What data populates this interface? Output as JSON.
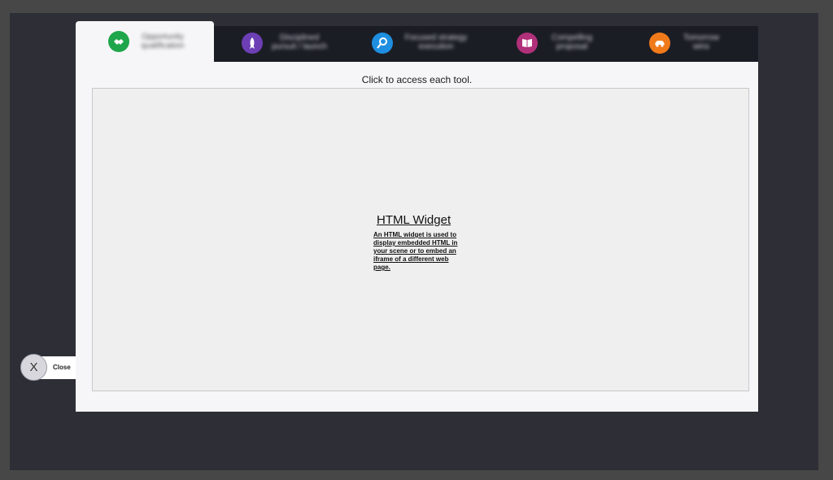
{
  "tabs": [
    {
      "label": "Opportunity\nqualification",
      "icon": "handshake-icon",
      "color": "#1fa64a",
      "active": true
    },
    {
      "label": "Disciplined\npursuit / launch",
      "icon": "rocket-icon",
      "color": "#6c3fb5",
      "active": false
    },
    {
      "label": "Focused strategy\nexecution",
      "icon": "magnifier-icon",
      "color": "#1e8fe0",
      "active": false
    },
    {
      "label": "Compelling\nproposal",
      "icon": "book-icon",
      "color": "#b0307a",
      "active": false
    },
    {
      "label": "Tomorrow\nwins",
      "icon": "car-icon",
      "color": "#f07a1a",
      "active": false
    }
  ],
  "instruction": "Click to access each tool.",
  "widget": {
    "title": "HTML Widget",
    "description": "An HTML widget is used to display embedded HTML in your scene or to embed an iframe of a different web page."
  },
  "close": {
    "symbol": "X",
    "label": "Close"
  }
}
